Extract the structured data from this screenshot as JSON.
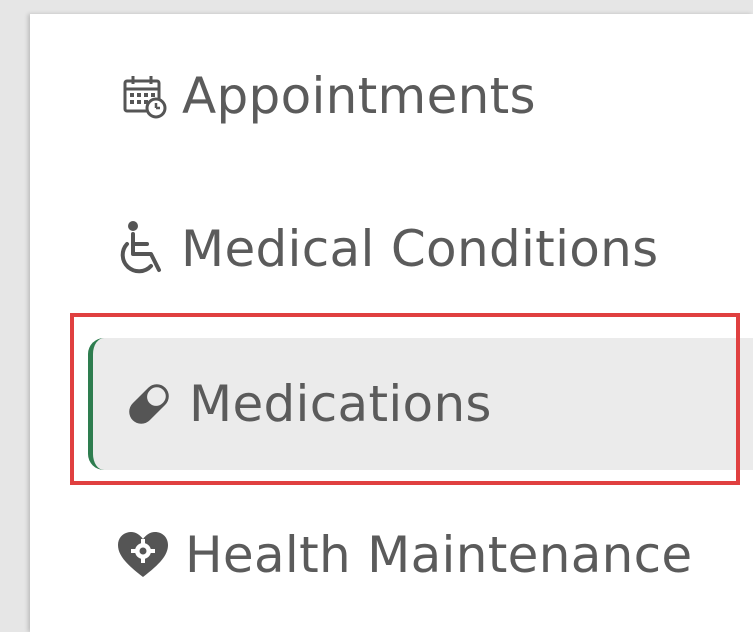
{
  "sidebar": {
    "items": [
      {
        "label": "Appointments",
        "icon": "calendar-clock-icon",
        "selected": false
      },
      {
        "label": "Medical Conditions",
        "icon": "wheelchair-icon",
        "selected": false
      },
      {
        "label": "Medications",
        "icon": "pill-icon",
        "selected": true
      },
      {
        "label": "Health Maintenance",
        "icon": "heart-gear-icon",
        "selected": false
      }
    ]
  },
  "colors": {
    "selected_accent": "#2e7d4f",
    "selected_background": "#ebebeb",
    "highlight_outline": "#e04040",
    "text": "#5b5b5b"
  }
}
